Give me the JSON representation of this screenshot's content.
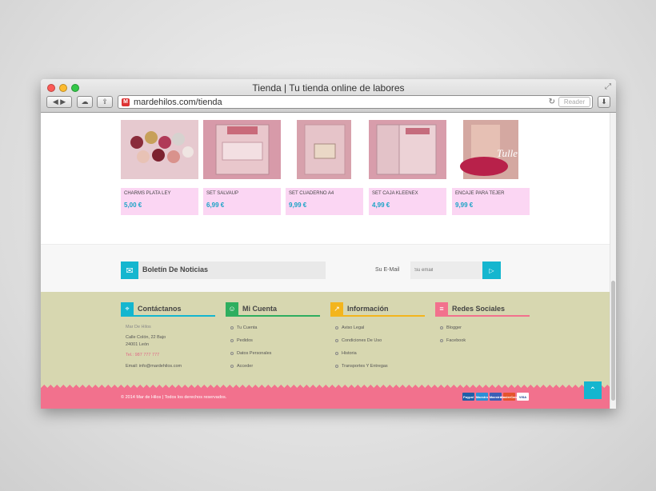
{
  "browser": {
    "title": "Tienda | Tu tienda online de labores",
    "url": "mardehilos.com/tienda",
    "reader_label": "Reader"
  },
  "products": [
    {
      "name": "CHARMS PLATA LEY",
      "price": "5,00 €"
    },
    {
      "name": "SET SALVAUP",
      "price": "6,99 €"
    },
    {
      "name": "SET CUADERNO A4",
      "price": "9,99 €"
    },
    {
      "name": "SET CAJA KLEENEX",
      "price": "4,99 €"
    },
    {
      "name": "ENCAJE PARA TEJER",
      "price": "9,99 €"
    }
  ],
  "newsletter": {
    "title": "Boletín De Noticias",
    "email_label": "Su E-Mail",
    "email_placeholder": "Su email"
  },
  "footer": {
    "contact": {
      "title": "Contáctanos",
      "name": "Mar De Hilos",
      "address1": "Calle Colón, 22 Bajo",
      "address2": "24001 León",
      "phone": "Tel.: 987 777 777",
      "email": "Email: info@mardehilos.com"
    },
    "account": {
      "title": "Mi Cuenta",
      "links": [
        "Tu Cuenta",
        "Pedidos",
        "Datos Personales",
        "Acceder"
      ]
    },
    "info": {
      "title": "Información",
      "links": [
        "Aviso Legal",
        "Condiciones De Uso",
        "Historia",
        "Transportes Y Entregas"
      ]
    },
    "social": {
      "title": "Redes Sociales",
      "links": [
        "Blogger",
        "Facebook"
      ]
    },
    "copyright": "© 2014 Mar de Hilos | Todos los derechos reservados.",
    "cards": [
      "Paypal",
      "Maestro",
      "Maestro",
      "MasterCard",
      "VISA"
    ]
  },
  "colors": {
    "accent": "#14b6cf",
    "pink": "#f2718d",
    "footer_bg": "#d7d7b0",
    "product_info": "#fbd6f3"
  }
}
